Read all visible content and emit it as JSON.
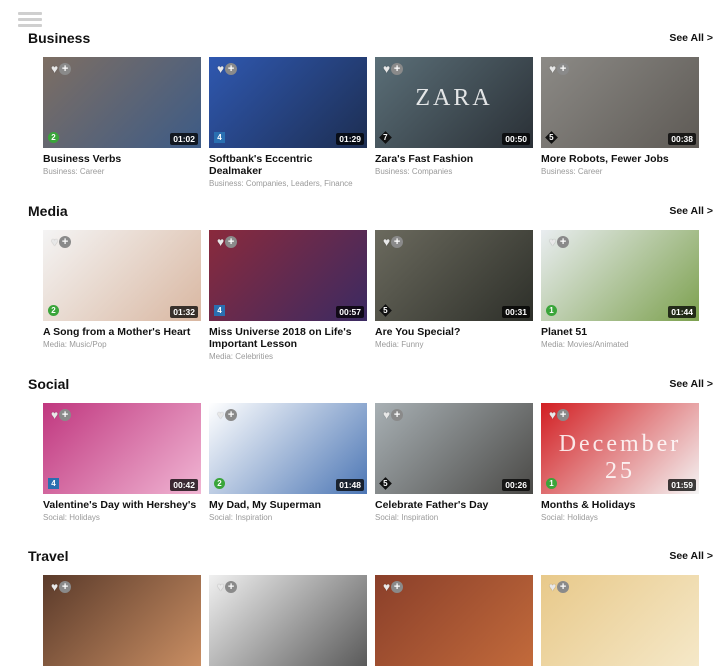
{
  "sections": [
    {
      "title": "Business",
      "see_all": "See All >",
      "cards": [
        {
          "title": "Business Verbs",
          "category": "Business: Career",
          "duration": "01:02",
          "level": "2",
          "colors": [
            "#7d6e63",
            "#3d5b86"
          ]
        },
        {
          "title": "Softbank's Eccentric Dealmaker",
          "category": "Business: Companies, Leaders, Finance",
          "duration": "01:29",
          "level": "4",
          "colors": [
            "#2f58b0",
            "#1d2e52"
          ]
        },
        {
          "title": "Zara's Fast Fashion",
          "category": "Business: Companies",
          "duration": "00:50",
          "level": "7",
          "colors": [
            "#5b6f78",
            "#2a3036"
          ],
          "art_text": "ZARA"
        },
        {
          "title": "More Robots, Fewer Jobs",
          "category": "Business: Career",
          "duration": "00:38",
          "level": "5",
          "colors": [
            "#8c8a86",
            "#5e5a55"
          ]
        }
      ]
    },
    {
      "title": "Media",
      "see_all": "See All >",
      "cards": [
        {
          "title": "A Song from a Mother's Heart",
          "category": "Media: Music/Pop",
          "duration": "01:32",
          "level": "2",
          "colors": [
            "#f4f4f4",
            "#d9b7a1"
          ]
        },
        {
          "title": "Miss Universe 2018 on Life's Important Lesson",
          "category": "Media: Celebrities",
          "duration": "00:57",
          "level": "4",
          "colors": [
            "#8a2a3c",
            "#3b2a62"
          ]
        },
        {
          "title": "Are You Special?",
          "category": "Media: Funny",
          "duration": "00:31",
          "level": "5",
          "colors": [
            "#6b6a5e",
            "#2d2f29"
          ]
        },
        {
          "title": "Planet 51",
          "category": "Media: Movies/Animated",
          "duration": "01:44",
          "level": "1",
          "colors": [
            "#e9edf0",
            "#7da14f"
          ]
        }
      ]
    },
    {
      "title": "Social",
      "see_all": "See All >",
      "cards": [
        {
          "title": "Valentine's Day with Hershey's",
          "category": "Social: Holidays",
          "duration": "00:42",
          "level": "4",
          "colors": [
            "#c0377f",
            "#f0b5d3"
          ]
        },
        {
          "title": "My Dad, My Superman",
          "category": "Social: Inspiration",
          "duration": "01:48",
          "level": "2",
          "colors": [
            "#ffffff",
            "#4d77b5"
          ]
        },
        {
          "title": "Celebrate Father's Day",
          "category": "Social: Inspiration",
          "duration": "00:26",
          "level": "5",
          "colors": [
            "#a8b0b4",
            "#4b4a47"
          ]
        },
        {
          "title": "Months & Holidays",
          "category": "Social: Holidays",
          "duration": "01:59",
          "level": "1",
          "colors": [
            "#d21e22",
            "#f4f4f4"
          ],
          "art_text": "December 25"
        }
      ]
    },
    {
      "title": "Travel",
      "see_all": "See All >",
      "cards": [
        {
          "colors": [
            "#5a3a2a",
            "#c98e63"
          ]
        },
        {
          "colors": [
            "#f0f0f0",
            "#5a5a5a"
          ]
        },
        {
          "colors": [
            "#8a3f2a",
            "#c26a3b"
          ]
        },
        {
          "colors": [
            "#e8c98a",
            "#f5e8c8"
          ]
        }
      ]
    }
  ],
  "icons": {
    "menu": "menu-icon",
    "favorite": "heart-icon",
    "add": "plus-icon"
  },
  "level_colors": {
    "1": "green",
    "2": "green",
    "4": "blue",
    "5": "black",
    "7": "black"
  }
}
